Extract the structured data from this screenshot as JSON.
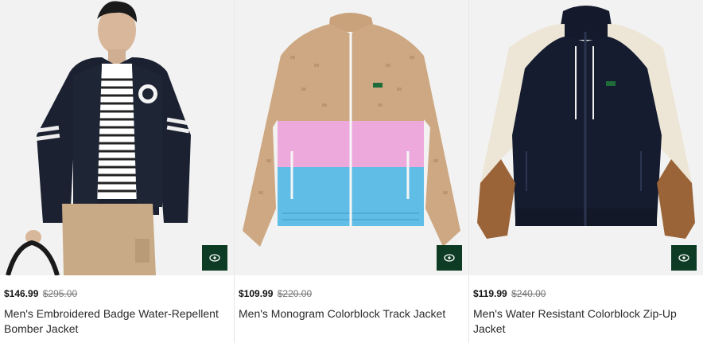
{
  "products": [
    {
      "price": "$146.99",
      "original_price": "$295.00",
      "name": "Men's Embroidered Badge Water-Repellent Bomber Jacket"
    },
    {
      "price": "$109.99",
      "original_price": "$220.00",
      "name": "Men's Monogram Colorblock Track Jacket"
    },
    {
      "price": "$119.99",
      "original_price": "$240.00",
      "name": "Men's Water Resistant Colorblock Zip-Up Jacket"
    }
  ],
  "colors": {
    "accent_green": "#128a3c",
    "quickview_bg": "#0d3b24"
  },
  "icons": {
    "wishlist": "heart-icon",
    "quick_view": "eye-icon"
  }
}
